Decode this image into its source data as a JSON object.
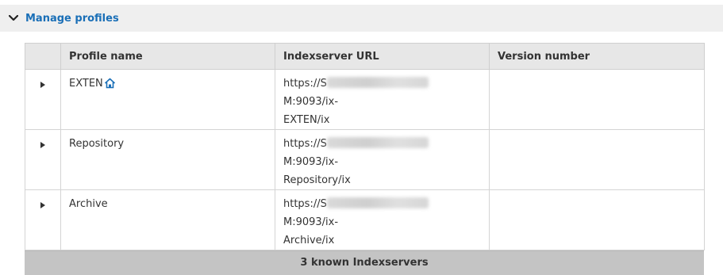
{
  "section": {
    "title": "Manage profiles",
    "chevron_icon": "chevron-down-icon"
  },
  "table": {
    "columns": [
      "",
      "Profile name",
      "Indexserver URL",
      "Version number"
    ],
    "rows": [
      {
        "profile_name": "EXTEN",
        "has_home_icon": true,
        "url_prefix": "https://S",
        "url_suffix": "M:9093/ix-",
        "url_line2": "EXTEN/ix",
        "version": ""
      },
      {
        "profile_name": "Repository",
        "has_home_icon": false,
        "url_prefix": "https://S",
        "url_suffix": "M:9093/ix-",
        "url_line2": "Repository/ix",
        "version": ""
      },
      {
        "profile_name": "Archive",
        "has_home_icon": false,
        "url_prefix": "https://S",
        "url_suffix": "M:9093/ix-",
        "url_line2": "Archive/ix",
        "version": ""
      }
    ],
    "footer": "3 known Indexservers"
  },
  "colors": {
    "accent": "#1a6fb7",
    "header_bg": "#efefef",
    "footer_bg": "#c4c4c4"
  }
}
